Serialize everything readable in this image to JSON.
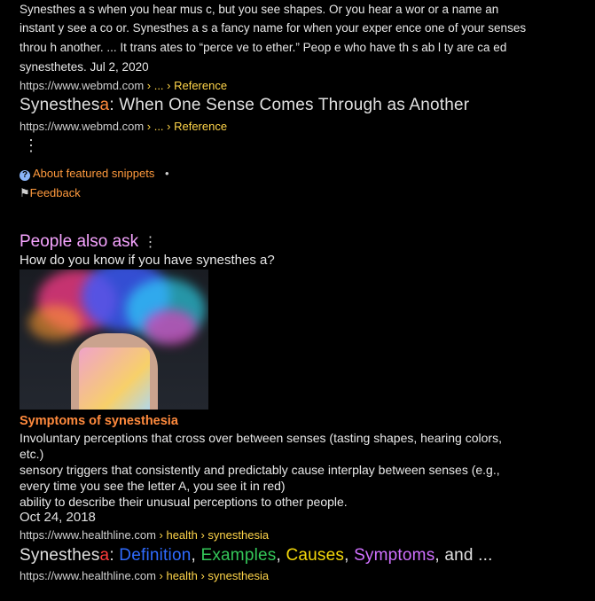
{
  "result1": {
    "snippet_line1": "Synesthes a s when you hear mus c, but you see shapes. Or you hear a wor  or a name an",
    "snippet_line2": "instant y see a co or. Synesthes a s a fancy name for when your exper ence one of your senses",
    "snippet_line3": "throu h another. ... It trans ates to “perce ve to ether.” Peop e who have th s ab l ty are ca ed",
    "snippet_line4": "synesthetes. Jul 2, 2020",
    "url": "https://www.webmd.com",
    "url_crumbs": " › ... › Reference"
  },
  "result2": {
    "title_plain": "Synesthes",
    "title_hl": "a",
    "title_rest": ": When One Sense Comes Through as Another",
    "url": "https://www.webmd.com",
    "url_crumbs": " › ... › Reference",
    "menu_glyph": "⋮"
  },
  "footer_links": {
    "about": "About featured snippets",
    "about_icon": "?",
    "bullet": "•",
    "feedback": "Feedback",
    "feedback_icon": "⚑"
  },
  "paa": {
    "title": "People also ask",
    "menu_glyph": "⋮",
    "question": "How do you know if you have synesthes a?",
    "symptom_title": "Symptoms of synesthesia",
    "symptoms": [
      "Involuntary perceptions that cross over between senses (tasting shapes, hearing colors,",
      "etc.)",
      "sensory triggers that consistently and predictably cause interplay between senses (e.g.,",
      "every time you see the letter A, you see it in red)",
      "ability to describe their unusual perceptions to other people."
    ],
    "date": "Oct 24, 2018",
    "url": "https://www.healthline.com",
    "url_crumbs": " › health › synesthesia"
  },
  "result3": {
    "title_a": "Synesthes",
    "title_b": "a",
    "title_c": ": ",
    "title_d": "Definition",
    "title_e": ", ",
    "title_f": "Examples",
    "title_g": ", ",
    "title_h": "Causes",
    "title_i": ", ",
    "title_j": "Symptoms",
    "title_k": ", and ...",
    "url": "https://www.healthline.com",
    "url_crumbs": " › health › synesthesia"
  }
}
